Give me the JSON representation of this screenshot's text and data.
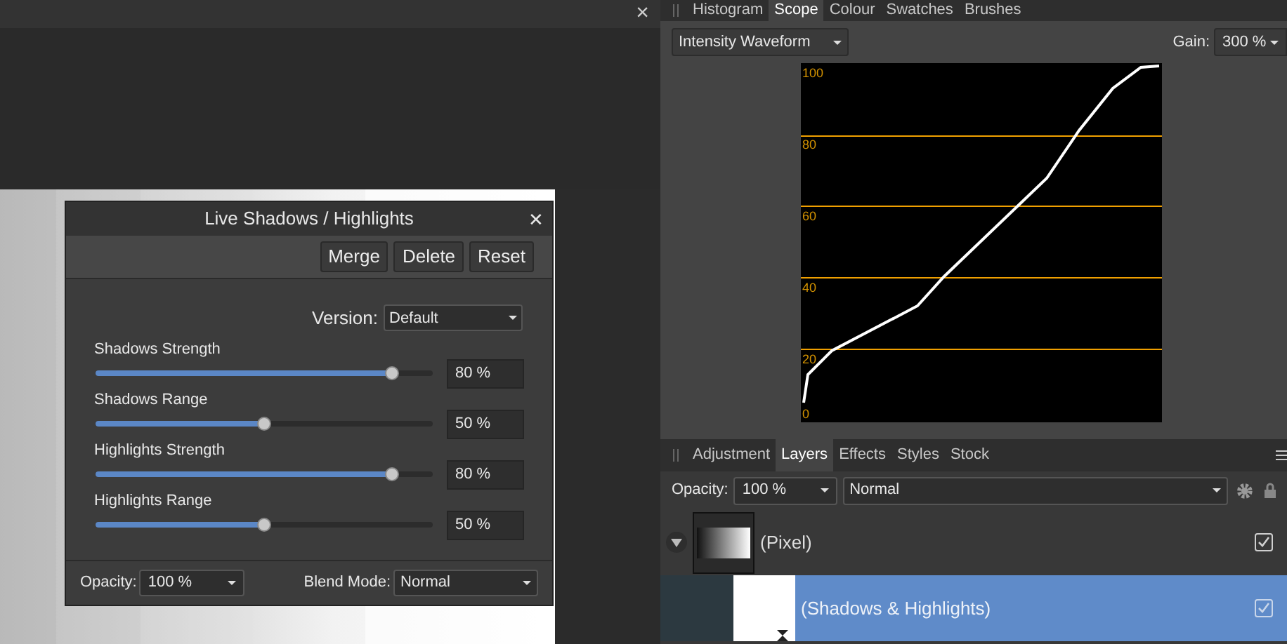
{
  "document": {
    "close_glyph": "×"
  },
  "dialog": {
    "title": "Live Shadows / Highlights",
    "close_glyph": "✕",
    "buttons": [
      "Merge",
      "Delete",
      "Reset"
    ],
    "version": {
      "label": "Version:",
      "value": "Default"
    },
    "sliders": [
      {
        "label": "Shadows Strength",
        "level": 0.88,
        "reading": "80 %"
      },
      {
        "label": "Shadows Range",
        "level": 0.5,
        "reading": "50 %"
      },
      {
        "label": "Highlights Strength",
        "level": 0.88,
        "reading": "80 %"
      },
      {
        "label": "Highlights Range",
        "level": 0.5,
        "reading": "50 %"
      }
    ],
    "opacity": {
      "label": "Opacity:",
      "value": "100 %"
    },
    "blend_mode": {
      "label": "Blend Mode:",
      "value": "Normal"
    }
  },
  "top_tabs": [
    {
      "label": "Histogram",
      "selected": false
    },
    {
      "label": "Scope",
      "selected": true
    },
    {
      "label": "Colour",
      "selected": false
    },
    {
      "label": "Swatches",
      "selected": false
    },
    {
      "label": "Brushes",
      "selected": false
    }
  ],
  "scope": {
    "mode": "Intensity Waveform",
    "gain_label": "Gain:",
    "gain": "300 %",
    "scale_labels": [
      "100",
      "80",
      "60",
      "40",
      "20",
      "0"
    ]
  },
  "bottom_tabs": [
    {
      "label": "Adjustment",
      "selected": false
    },
    {
      "label": "Layers",
      "selected": true
    },
    {
      "label": "Effects",
      "selected": false
    },
    {
      "label": "Styles",
      "selected": false
    },
    {
      "label": "Stock",
      "selected": false
    }
  ],
  "layers_toolbar": {
    "opacity_label": "Opacity:",
    "opacity": "100 %",
    "blend_mode": "Normal"
  },
  "layers": [
    {
      "name": "(Pixel)",
      "kind": "pixel",
      "expanded": true,
      "selected": false,
      "visible": true,
      "children": [
        {
          "name": "(Shadows & Highlights)",
          "kind": "adjustment",
          "selected": true,
          "visible": true
        }
      ]
    }
  ]
}
